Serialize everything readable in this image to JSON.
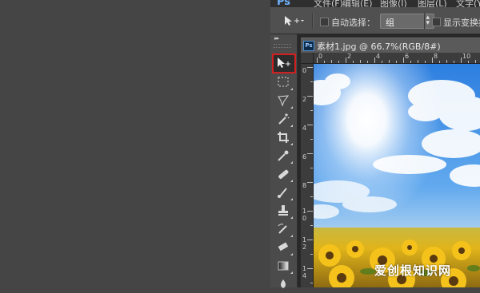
{
  "app": {
    "logo": "Ps"
  },
  "menu": [
    "文件(F)",
    "编辑(E)",
    "图像(I)",
    "图层(L)",
    "文字(Y)"
  ],
  "options": {
    "auto_select_label": "自动选择：",
    "auto_select_value": "组",
    "show_transform_label": "显示变换控件"
  },
  "tools": [
    "move-tool-icon",
    "marquee-tool-icon",
    "lasso-tool-icon",
    "magic-wand-tool-icon",
    "crop-tool-icon",
    "eyedropper-tool-icon",
    "healing-brush-tool-icon",
    "brush-tool-icon",
    "clone-stamp-tool-icon",
    "history-brush-tool-icon",
    "eraser-tool-icon",
    "gradient-tool-icon",
    "blur-tool-icon"
  ],
  "document": {
    "badge": "Ps",
    "title": "素材1.jpg @ 66.7%(RGB/8#)"
  },
  "rulers": {
    "top": [
      "0",
      "2",
      "4",
      "6",
      "8",
      "10",
      "12"
    ],
    "left": [
      "0",
      "2",
      "4",
      "6",
      "8",
      "1\n0",
      "1\n2",
      "1\n4"
    ]
  },
  "watermark": "爱创根知识网",
  "colors": {
    "active_tool_highlight": "#d21f1f",
    "panel": "#4b4b4b",
    "ps_blue": "#6fb3ff"
  }
}
